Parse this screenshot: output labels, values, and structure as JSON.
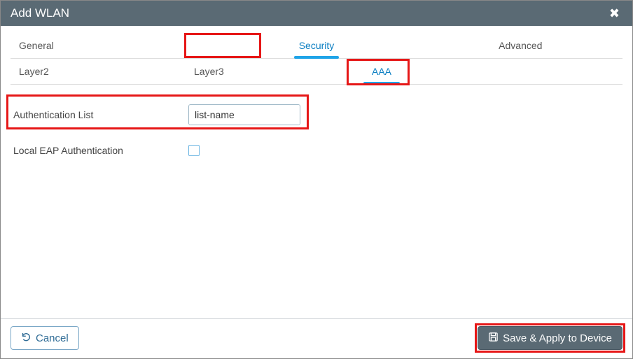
{
  "window": {
    "title": "Add WLAN"
  },
  "tabs": {
    "general": "General",
    "security": "Security",
    "advanced": "Advanced",
    "active": "Security"
  },
  "subtabs": {
    "layer2": "Layer2",
    "layer3": "Layer3",
    "aaa": "AAA",
    "active": "AAA"
  },
  "form": {
    "auth_list_label": "Authentication List",
    "auth_list_value": "list-name",
    "local_eap_label": "Local EAP Authentication",
    "local_eap_checked": false
  },
  "footer": {
    "cancel_label": "Cancel",
    "save_label": "Save & Apply to Device"
  },
  "highlight_boxes": [
    {
      "area": "tab-security"
    },
    {
      "area": "subtab-aaa"
    },
    {
      "area": "row-auth-list"
    },
    {
      "area": "btn-save"
    }
  ]
}
